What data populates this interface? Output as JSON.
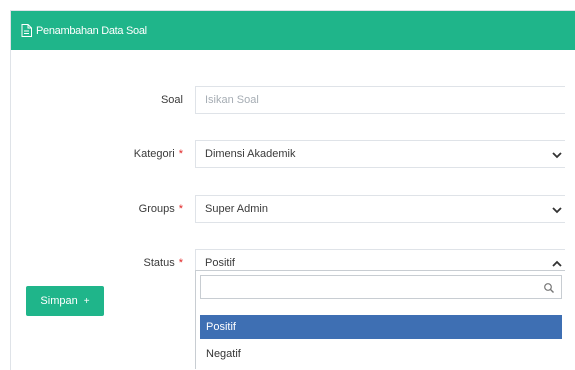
{
  "panel": {
    "title": "Penambahan Data Soal",
    "header_color": "#1fb58a"
  },
  "form": {
    "soal": {
      "label": "Soal",
      "placeholder": "Isikan Soal"
    },
    "kategori": {
      "label": "Kategori",
      "required": "*",
      "value": "Dimensi Akademik"
    },
    "groups": {
      "label": "Groups",
      "required": "*",
      "value": "Super Admin"
    },
    "status": {
      "label": "Status",
      "required": "*",
      "value": "Positif",
      "options": [
        "Positif",
        "Negatif"
      ],
      "highlighted": "Positif"
    }
  },
  "actions": {
    "save_label": "Simpan",
    "save_icon": "+"
  },
  "icons": {
    "header": "document-icon",
    "select_closed": "chevron-down-icon",
    "select_open": "chevron-up-icon",
    "search": "search-icon"
  },
  "colors": {
    "accent": "#1fb58a",
    "highlight": "#3e6fb3",
    "required": "#e02424"
  }
}
